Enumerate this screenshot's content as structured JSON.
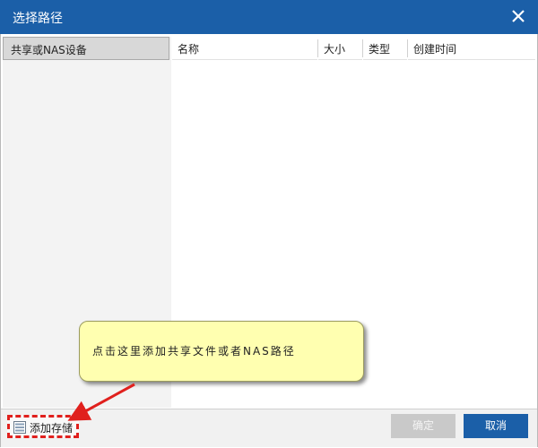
{
  "window": {
    "title": "选择路径"
  },
  "sidebar": {
    "header": "共享或NAS设备"
  },
  "columns": [
    {
      "label": "名称"
    },
    {
      "label": "大小"
    },
    {
      "label": "类型"
    },
    {
      "label": "创建时间"
    }
  ],
  "footer": {
    "add_storage_label": "添加存储",
    "ok_label": "确定",
    "cancel_label": "取消"
  },
  "callout": {
    "text": "点击这里添加共享文件或者NAS路径"
  },
  "colors": {
    "titlebar": "#1b5fa8",
    "highlight": "#e0201d",
    "callout_bg": "#ffffb0"
  }
}
